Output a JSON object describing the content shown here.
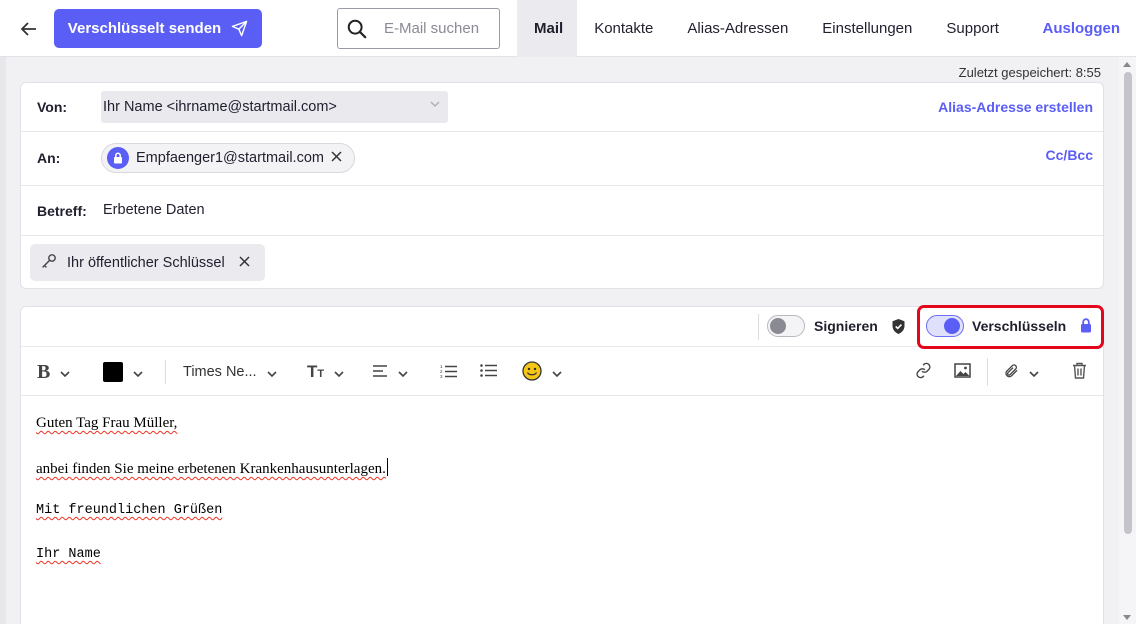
{
  "topbar": {
    "send_label": "Verschlüsselt senden",
    "search_placeholder": "E-Mail suchen",
    "nav": [
      {
        "label": "Mail",
        "active": true
      },
      {
        "label": "Kontakte"
      },
      {
        "label": "Alias-Adressen"
      },
      {
        "label": "Einstellungen"
      },
      {
        "label": "Support"
      }
    ],
    "logout_label": "Ausloggen"
  },
  "status": {
    "saved_text": "Zuletzt gespeichert: 8:55"
  },
  "header": {
    "from_label": "Von:",
    "from_value": "Ihr Name <ihrname@startmail.com>",
    "alias_link": "Alias-Adresse erstellen",
    "to_label": "An:",
    "recipient": "Empfaenger1@startmail.com",
    "ccbcc_link": "Cc/Bcc",
    "subject_label": "Betreff:",
    "subject_value": "Erbetene Daten",
    "key_attachment": "Ihr öffentlicher Schlüssel"
  },
  "editor": {
    "sign_label": "Signieren",
    "sign_enabled": false,
    "encrypt_label": "Verschlüsseln",
    "encrypt_enabled": true,
    "font_name": "Times Ne...",
    "text_color": "#000000",
    "body": {
      "greeting": "Guten Tag Frau Müller,",
      "line1": "anbei finden Sie meine erbetenen Krankenhausunterlagen.",
      "closing": "Mit freundlichen Grüßen",
      "signature": "Ihr Name"
    }
  },
  "colors": {
    "accent": "#5b5ef5",
    "highlight": "#e3061a"
  }
}
